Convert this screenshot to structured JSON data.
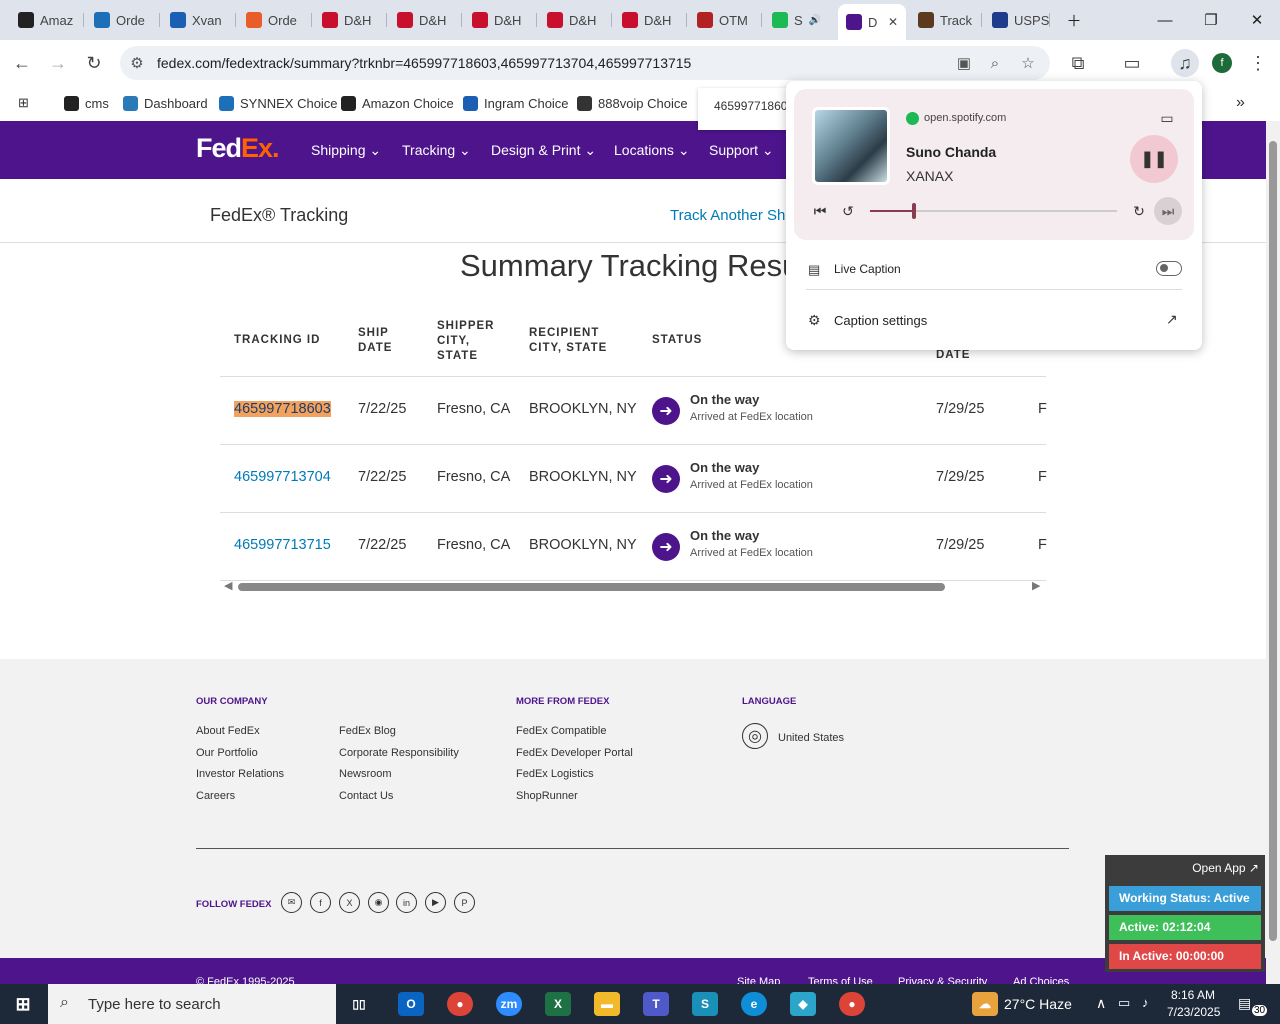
{
  "browser": {
    "tabs": [
      {
        "label": "Amaz",
        "color": "#222"
      },
      {
        "label": "Orde",
        "color": "#1d6fb8"
      },
      {
        "label": "Xvan",
        "color": "#1a5fb4"
      },
      {
        "label": "Orde",
        "color": "#e85d2a"
      },
      {
        "label": "D&H",
        "color": "#c8102e"
      },
      {
        "label": "D&H",
        "color": "#c8102e"
      },
      {
        "label": "D&H",
        "color": "#c8102e"
      },
      {
        "label": "D&H",
        "color": "#c8102e"
      },
      {
        "label": "D&H",
        "color": "#c8102e"
      },
      {
        "label": "OTM",
        "color": "#b22222"
      },
      {
        "label": "S",
        "color": "#1db954"
      },
      {
        "label": "D",
        "color": "#4d148c",
        "active": true
      },
      {
        "label": "Track",
        "color": "#5c3a1e"
      },
      {
        "label": "USPS",
        "color": "#1f3b8c"
      }
    ],
    "url": "fedex.com/fedextrack/summary?trknbr=465997718603,465997713704,465997713715",
    "bookmarks": [
      {
        "label": "cms",
        "color": "#222"
      },
      {
        "label": "Dashboard",
        "color": "#2a7ab8"
      },
      {
        "label": "SYNNEX Choice",
        "color": "#1d6fb8"
      },
      {
        "label": "Amazon Choice",
        "color": "#222"
      },
      {
        "label": "Ingram Choice",
        "color": "#1a5fb4"
      },
      {
        "label": "888voip Choice",
        "color": "#333"
      }
    ],
    "find_bar_text": "46599771860"
  },
  "fedex": {
    "logo_fed": "Fed",
    "logo_ex": "Ex.",
    "nav": [
      "Shipping",
      "Tracking",
      "Design & Print",
      "Locations",
      "Support"
    ],
    "subheader_title": "FedEx® Tracking",
    "track_another": "Track Another Sh",
    "summary_title": "Summary Tracking Result",
    "columns": [
      "TRACKING ID",
      "SHIP DATE",
      "SHIPPER CITY, STATE",
      "RECIPIENT CITY, STATE",
      "STATUS",
      "DATE"
    ],
    "hidden_col_partial": "DATE",
    "rows": [
      {
        "id": "465997718603",
        "ship": "7/22/25",
        "shipper": "Fresno, CA",
        "recipient": "BROOKLYN, NY",
        "status": "On the way",
        "substatus": "Arrived at FedEx location",
        "date": "7/29/25",
        "extra": "F"
      },
      {
        "id": "465997713704",
        "ship": "7/22/25",
        "shipper": "Fresno, CA",
        "recipient": "BROOKLYN, NY",
        "status": "On the way",
        "substatus": "Arrived at FedEx location",
        "date": "7/29/25",
        "extra": "F"
      },
      {
        "id": "465997713715",
        "ship": "7/22/25",
        "shipper": "Fresno, CA",
        "recipient": "BROOKLYN, NY",
        "status": "On the way",
        "substatus": "Arrived at FedEx location",
        "date": "7/29/25",
        "extra": "F"
      }
    ],
    "footer": {
      "our_company": "OUR COMPANY",
      "col1": [
        "About FedEx",
        "Our Portfolio",
        "Investor Relations",
        "Careers"
      ],
      "col2": [
        "FedEx Blog",
        "Corporate Responsibility",
        "Newsroom",
        "Contact Us"
      ],
      "more_from": "MORE FROM FEDEX",
      "col3": [
        "FedEx Compatible",
        "FedEx Developer Portal",
        "FedEx Logistics",
        "ShopRunner"
      ],
      "language": "LANGUAGE",
      "language_value": "United States",
      "follow": "FOLLOW FEDEX",
      "copyright": "© FedEx 1995-2025",
      "bottom_links": [
        "Site Map",
        "Terms of Use",
        "Privacy & Security",
        "Ad Choices"
      ]
    }
  },
  "media": {
    "source": "open.spotify.com",
    "track": "Suno Chanda",
    "artist": "XANAX",
    "progress": 0.18,
    "live_caption": "Live Caption",
    "caption_settings": "Caption settings"
  },
  "monitor": {
    "open_app": "Open App ↗",
    "working": "Working Status: Active",
    "active": "Active: 02:12:04",
    "inactive": "In Active: 00:00:00"
  },
  "taskbar": {
    "search_placeholder": "Type here to search",
    "weather": "27°C  Haze",
    "time": "8:16 AM",
    "date": "7/23/2025",
    "notif": "30"
  }
}
